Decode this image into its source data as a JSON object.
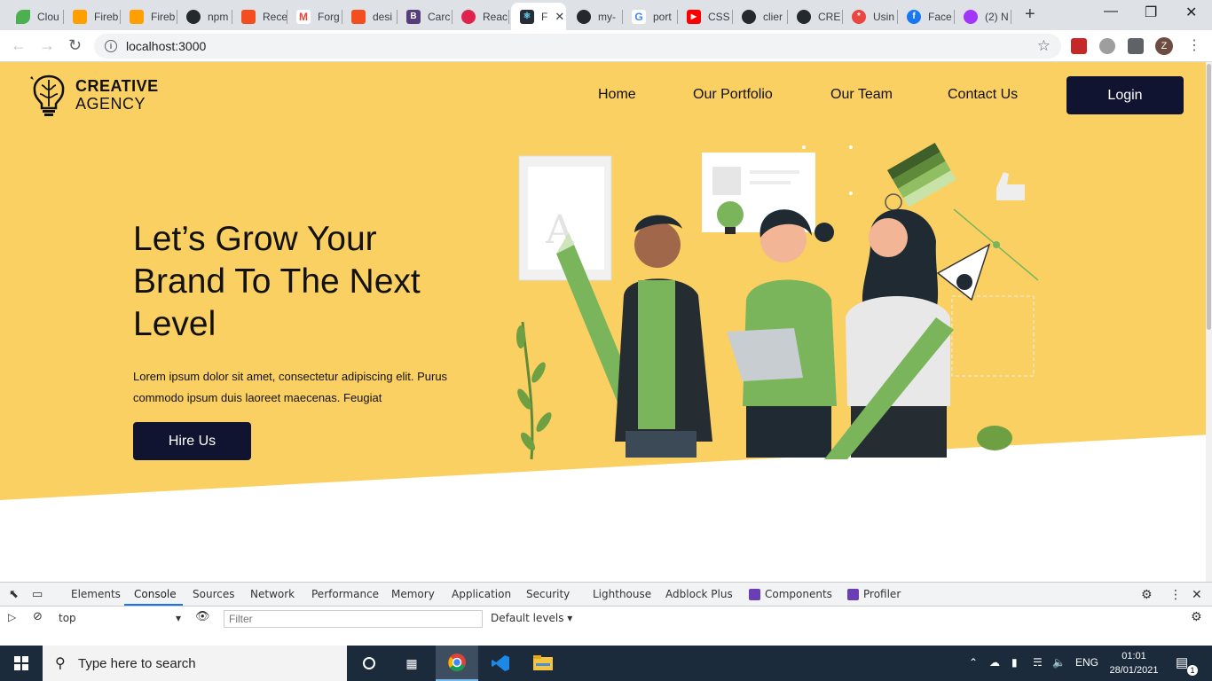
{
  "browser": {
    "tabs": [
      {
        "label": "Clou",
        "color": "#4caf50"
      },
      {
        "label": "Fireb",
        "color": "#ffa000"
      },
      {
        "label": "Fireb",
        "color": "#ffa000"
      },
      {
        "label": "npm",
        "color": "#24292e"
      },
      {
        "label": "Rece",
        "color": "#f24e1e"
      },
      {
        "label": "Forg",
        "color": "#ea4335"
      },
      {
        "label": "desi",
        "color": "#f24e1e"
      },
      {
        "label": "Carc",
        "color": "#563d7c"
      },
      {
        "label": "Reac",
        "color": "#e0234e"
      },
      {
        "label": "F",
        "color": "#282c34",
        "active": true
      },
      {
        "label": "my-",
        "color": "#24292e"
      },
      {
        "label": "port",
        "color": "#4285f4"
      },
      {
        "label": "CSS",
        "color": "#ff0000"
      },
      {
        "label": "clier",
        "color": "#24292e"
      },
      {
        "label": "CRE",
        "color": "#24292e"
      },
      {
        "label": "Usin",
        "color": "#e8463f"
      },
      {
        "label": "Face",
        "color": "#1877f2"
      },
      {
        "label": "(2) N",
        "color": "#a334fa"
      }
    ],
    "address": "localhost:3000",
    "profile_initial": "Z"
  },
  "site": {
    "logo_line1": "CREATIVE",
    "logo_line2": "AGENCY",
    "nav": [
      "Home",
      "Our Portfolio",
      "Our Team",
      "Contact Us"
    ],
    "login_label": "Login",
    "headline": "Let’s Grow Your Brand To The Next Level",
    "subtext": "Lorem ipsum dolor sit amet, consectetur adipiscing elit. Purus commodo ipsum duis laoreet maecenas. Feugiat",
    "cta_label": "Hire Us",
    "hero_color": "#fbd062",
    "button_color": "#111430"
  },
  "devtools": {
    "tabs": [
      "Elements",
      "Console",
      "Sources",
      "Network",
      "Performance",
      "Memory",
      "Application",
      "Security",
      "Lighthouse",
      "Adblock Plus",
      "Components",
      "Profiler"
    ],
    "active_tab": "Console",
    "context": "top",
    "filter_placeholder": "Filter",
    "levels": "Default levels"
  },
  "taskbar": {
    "search_placeholder": "Type here to search",
    "language": "ENG",
    "time": "01:01",
    "date": "28/01/2021",
    "notification_count": "1"
  }
}
